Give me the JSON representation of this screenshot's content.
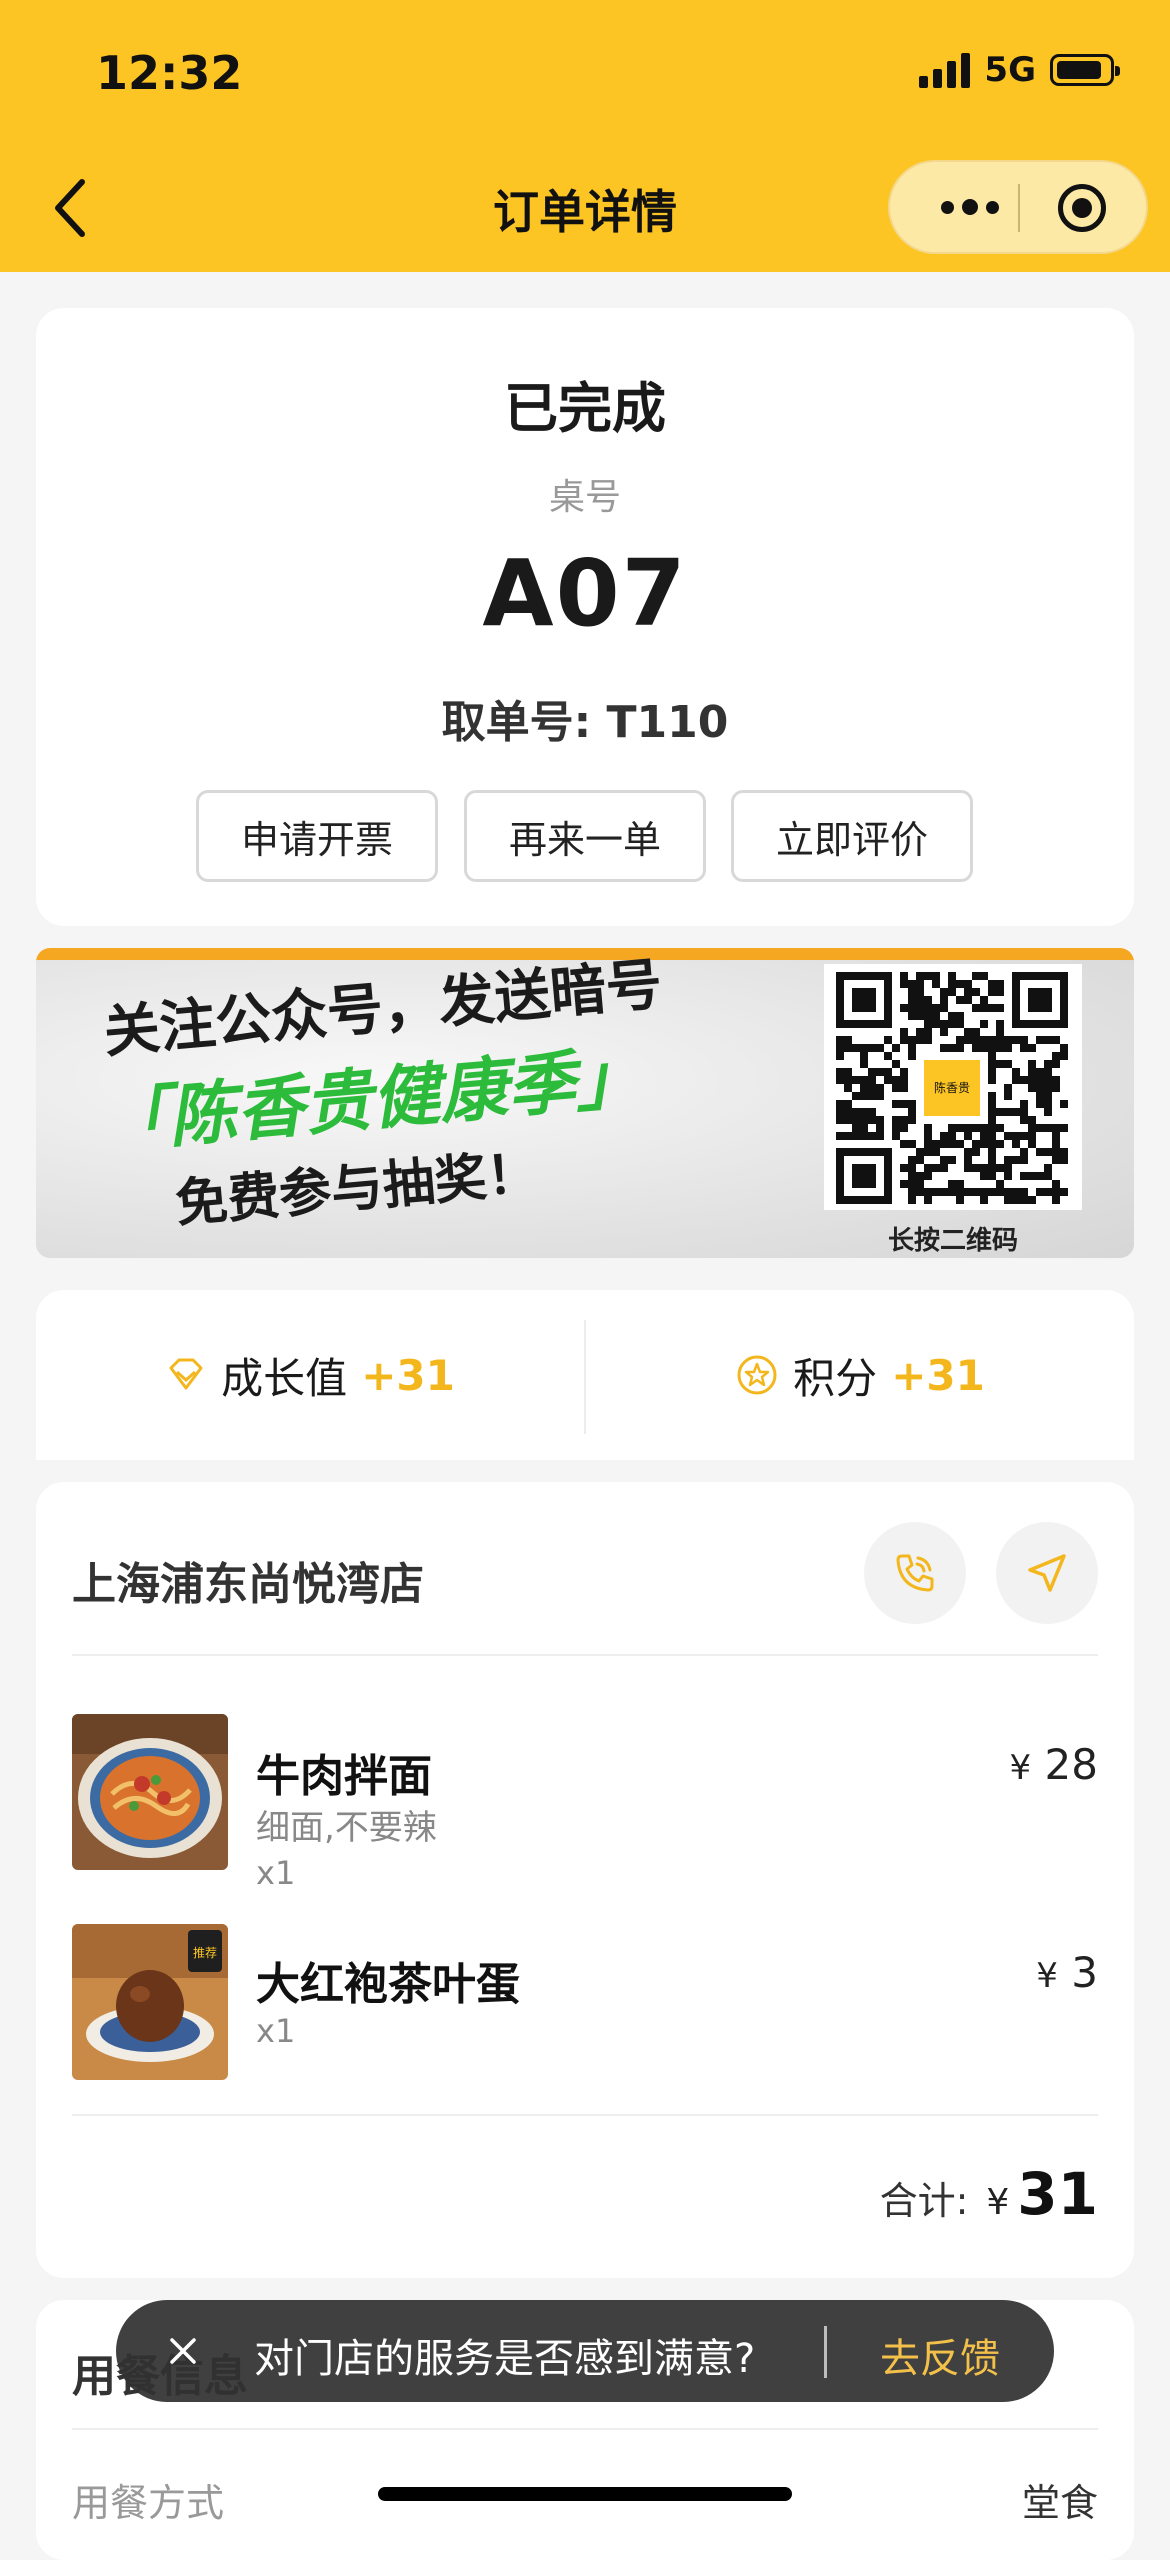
{
  "status_bar": {
    "time": "12:32",
    "network": "5G"
  },
  "nav": {
    "title": "订单详情"
  },
  "order": {
    "status": "已完成",
    "table_label": "桌号",
    "table_number": "A07",
    "order_number_text": "取单号: T110",
    "actions": [
      "申请开票",
      "再来一单",
      "立即评价"
    ]
  },
  "banner": {
    "line1": "关注公众号，发送暗号",
    "line2": "「陈香贵健康季」",
    "line3": "免费参与抽奖！",
    "qr_caption": "长按二维码",
    "qr_logo_text": "陈香贵"
  },
  "points": {
    "growth_label": "成长值",
    "growth_value": "+31",
    "score_label": "积分",
    "score_value": "+31"
  },
  "store": {
    "name": "上海浦东尚悦湾店",
    "items": [
      {
        "name": "牛肉拌面",
        "note": "细面,不要辣",
        "qty": "x1",
        "currency": "¥",
        "price": "28"
      },
      {
        "name": "大红袍茶叶蛋",
        "qty": "x1",
        "currency": "¥",
        "price": "3",
        "badge": "推荐"
      }
    ],
    "total_label": "合计:",
    "total_currency": "¥",
    "total_value": "31"
  },
  "dining": {
    "title": "用餐信息",
    "mode_label": "用餐方式",
    "mode_value": "堂食"
  },
  "toast": {
    "text": "对门店的服务是否感到满意?",
    "link": "去反馈"
  },
  "colors": {
    "brand_yellow": "#fcc524",
    "accent_green": "#2dbb3c",
    "points_gold": "#f3b71d"
  }
}
